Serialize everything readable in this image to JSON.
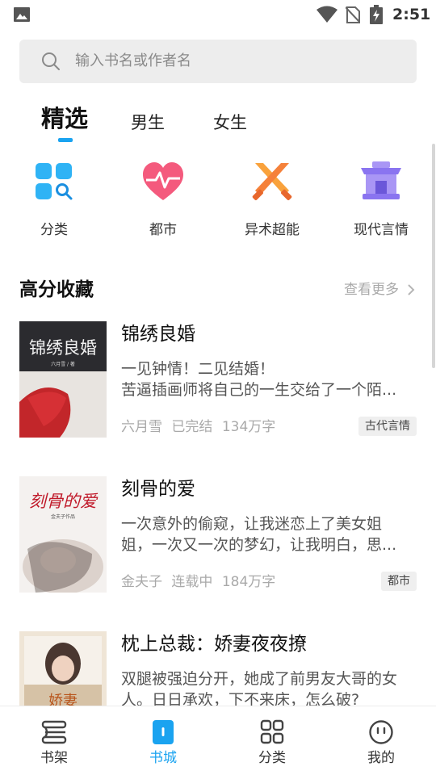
{
  "status_bar": {
    "time": "2:51",
    "icons": [
      "image-icon",
      "wifi-icon",
      "no-sim-icon",
      "battery-charging-icon"
    ]
  },
  "search": {
    "placeholder": "输入书名或作者名",
    "icon": "search-icon"
  },
  "tabs": [
    {
      "label": "精选",
      "active": true
    },
    {
      "label": "男生",
      "active": false
    },
    {
      "label": "女生",
      "active": false
    }
  ],
  "categories": [
    {
      "label": "分类",
      "icon": "category-grid-icon",
      "color": "#2fb3f5"
    },
    {
      "label": "都市",
      "icon": "heart-pulse-icon",
      "color": "#f45a7d"
    },
    {
      "label": "异术超能",
      "icon": "crossed-swords-icon",
      "color": "#f5813a"
    },
    {
      "label": "现代言情",
      "icon": "pavilion-icon",
      "color": "#8a74f0"
    }
  ],
  "section": {
    "title": "高分收藏",
    "more": "查看更多",
    "more_icon": "chevron-right-icon"
  },
  "books": [
    {
      "title": "锦绣良婚",
      "desc_line1": "一见钟情！二见结婚！",
      "desc_line2": "苦逼插画师将自己的一生交给了一个陌...",
      "author": "六月雪",
      "status": "已完结",
      "words": "134万字",
      "tag": "古代言情",
      "cover_text": "锦绣良婚"
    },
    {
      "title": "刻骨的爱",
      "desc_line1": "一次意外的偷窥，让我迷恋上了美女姐",
      "desc_line2": "姐，一次又一次的梦幻，让我明白，思...",
      "author": "金夫子",
      "status": "连载中",
      "words": "184万字",
      "tag": "都市",
      "cover_text": "刻骨的爱"
    },
    {
      "title": "枕上总裁：娇妻夜夜撩",
      "desc_line1": "双腿被强迫分开，她成了前男友大哥的女",
      "desc_line2": "人。日日承欢，下不来床，怎么破?",
      "author": "",
      "status": "",
      "words": "",
      "tag": "",
      "cover_text": ""
    }
  ],
  "bottom_nav": [
    {
      "label": "书架",
      "icon": "bookshelf-icon",
      "active": false
    },
    {
      "label": "书城",
      "icon": "bookstore-icon",
      "active": true
    },
    {
      "label": "分类",
      "icon": "grid-icon",
      "active": false
    },
    {
      "label": "我的",
      "icon": "profile-face-icon",
      "active": false
    }
  ],
  "colors": {
    "accent": "#1aa3f0",
    "muted_text": "#a9a9a9",
    "search_bg": "#ededed"
  }
}
